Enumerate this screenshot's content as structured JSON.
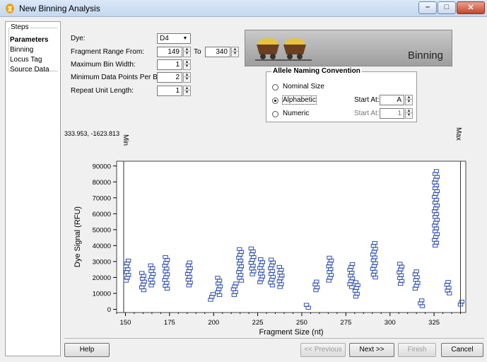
{
  "window": {
    "title": "New Binning Analysis"
  },
  "steps": {
    "legend": "Steps",
    "items": [
      "Parameters",
      "Binning",
      "Locus Tag",
      "Source Data"
    ],
    "active_index": 0
  },
  "params": {
    "dye_label": "Dye:",
    "dye_value": "D4",
    "fragment_from_label": "Fragment Range From:",
    "fragment_from_value": "149",
    "to_label": "To",
    "fragment_to_value": "340",
    "max_bin_width_label": "Maximum Bin Width:",
    "max_bin_width_value": "1",
    "min_points_label": "Minimum Data Points Per Bin:",
    "min_points_value": "2",
    "repeat_unit_label": "Repeat Unit Length:",
    "repeat_unit_value": "1"
  },
  "banner": {
    "title": "Binning"
  },
  "allele": {
    "legend": "Allele Naming Convention",
    "options": [
      "Nominal Size",
      "Alphabetic",
      "Numeric"
    ],
    "selected": "Alphabetic",
    "start_at_label": "Start At:",
    "start_alpha": "A",
    "start_numeric": "1"
  },
  "readout": {
    "coords": "333.953, -1623.813"
  },
  "markers": {
    "min_label": "Min",
    "max_label": "Max"
  },
  "chart_data": {
    "type": "scatter",
    "xlabel": "Fragment Size (nt)",
    "ylabel": "Dye Signal (RFU)",
    "xlim": [
      145,
      343
    ],
    "ylim": [
      -2000,
      93000
    ],
    "xticks": [
      150,
      175,
      200,
      225,
      250,
      275,
      300,
      325
    ],
    "yticks": [
      0,
      10000,
      20000,
      30000,
      40000,
      50000,
      60000,
      70000,
      80000,
      90000
    ],
    "ytick_labels": [
      "0",
      "10000",
      "20000",
      "30000",
      "40000",
      "50000",
      "60000",
      "70000",
      "80000",
      "90000"
    ],
    "min_marker": 149,
    "max_marker": 340,
    "marker_color": "#2f4fb0",
    "clusters": [
      {
        "x": 151,
        "ymin": 18000,
        "ymax": 32000
      },
      {
        "x": 160,
        "ymin": 12000,
        "ymax": 23000
      },
      {
        "x": 165,
        "ymin": 15000,
        "ymax": 29000
      },
      {
        "x": 173,
        "ymin": 13000,
        "ymax": 33000
      },
      {
        "x": 186,
        "ymin": 15000,
        "ymax": 30000
      },
      {
        "x": 199,
        "ymin": 6000,
        "ymax": 11000
      },
      {
        "x": 203,
        "ymin": 9000,
        "ymax": 20000
      },
      {
        "x": 212,
        "ymin": 9000,
        "ymax": 17000
      },
      {
        "x": 215,
        "ymin": 18000,
        "ymax": 38000
      },
      {
        "x": 222,
        "ymin": 22000,
        "ymax": 39000
      },
      {
        "x": 227,
        "ymin": 17000,
        "ymax": 33000
      },
      {
        "x": 233,
        "ymin": 15000,
        "ymax": 32000
      },
      {
        "x": 238,
        "ymin": 14000,
        "ymax": 27000
      },
      {
        "x": 253,
        "ymin": 1000,
        "ymax": 4000
      },
      {
        "x": 258,
        "ymin": 12000,
        "ymax": 19000
      },
      {
        "x": 266,
        "ymin": 18000,
        "ymax": 34000
      },
      {
        "x": 278,
        "ymin": 14000,
        "ymax": 29000
      },
      {
        "x": 281,
        "ymin": 8000,
        "ymax": 17000
      },
      {
        "x": 291,
        "ymin": 20000,
        "ymax": 43000
      },
      {
        "x": 306,
        "ymin": 16000,
        "ymax": 29000
      },
      {
        "x": 315,
        "ymin": 13000,
        "ymax": 24000
      },
      {
        "x": 318,
        "ymin": 2000,
        "ymax": 6000
      },
      {
        "x": 326,
        "ymin": 40000,
        "ymax": 88000
      },
      {
        "x": 333,
        "ymin": 10000,
        "ymax": 18000
      },
      {
        "x": 340,
        "ymin": 3000,
        "ymax": 5000
      }
    ]
  },
  "buttons": {
    "help": "Help",
    "previous": "<< Previous",
    "next": "Next >>",
    "finish": "Finish",
    "cancel": "Cancel"
  }
}
